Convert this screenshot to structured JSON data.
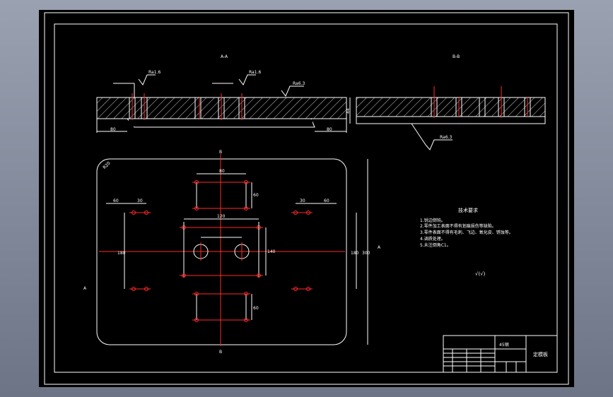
{
  "drawing": {
    "section_labels": {
      "a_a": "A-A",
      "b_b": "B-B"
    },
    "roughness": [
      "Ra1.6",
      "Ra1.6",
      "Ra6.3",
      "Ra6.3"
    ],
    "dims_top": [
      "80",
      "80",
      "44"
    ],
    "dims_plan": {
      "top_width": "80",
      "row2_width": "120",
      "left_w": "60",
      "left_w2": "30",
      "right_w": "30",
      "right_w2": "60",
      "h60_a": "60",
      "h60_b": "60",
      "v_left": "180",
      "v_mid": "140",
      "v_right": "180",
      "v_far": "300",
      "radius": "R20"
    },
    "view_markers": {
      "b_top": "B",
      "b_bottom": "B",
      "a_left": "A",
      "a_right": "A"
    },
    "tech_title": "技术要求",
    "tech_items": [
      "1.锐边倒钝。",
      "2.零件加工表面不得有划痕损伤等缺陷。",
      "3.零件表面不得有毛刺、飞边、氧化皮、锈蚀等。",
      "4.调质处理。",
      "5.未注倒角C1。"
    ],
    "rough_note": "√(√)",
    "title_block": {
      "material": "45钢",
      "part_name": "定模板"
    }
  }
}
